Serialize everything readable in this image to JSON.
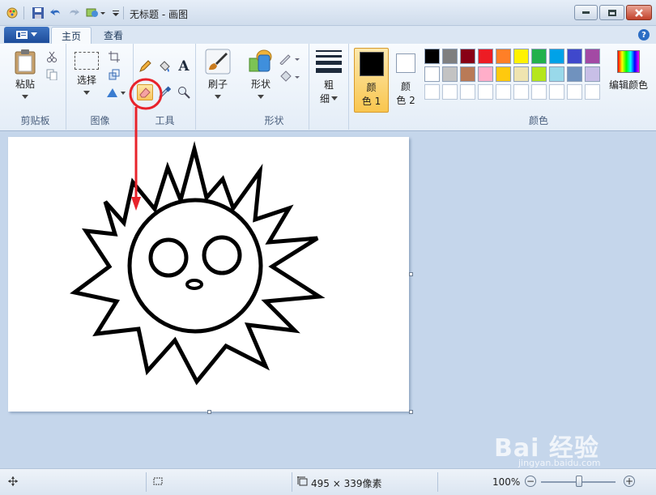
{
  "title_bar": {
    "title": "无标题 - 画图"
  },
  "tabs": {
    "home": "主页",
    "view": "查看"
  },
  "ribbon": {
    "clipboard": {
      "paste": "粘贴",
      "group": "剪贴板"
    },
    "image": {
      "select": "选择",
      "group": "图像"
    },
    "tools": {
      "group": "工具",
      "text_icon": "A"
    },
    "brushes": {
      "label": "刷子"
    },
    "shapes": {
      "label": "形状",
      "group": "形状"
    },
    "size": {
      "line1": "粗",
      "line2": "细"
    },
    "color1": {
      "line1": "颜",
      "line2": "色 1"
    },
    "color2": {
      "line1": "颜",
      "line2": "色 2"
    },
    "colors": {
      "group": "颜色",
      "edit": "编辑颜色"
    }
  },
  "palette_row1": [
    "#000000",
    "#7f7f7f",
    "#880015",
    "#ed1c24",
    "#ff7f27",
    "#fff200",
    "#22b14c",
    "#00a2e8",
    "#3f48cc",
    "#a349a4"
  ],
  "palette_row2": [
    "#ffffff",
    "#c3c3c3",
    "#b97a57",
    "#ffaec9",
    "#ffc90e",
    "#efe4b0",
    "#b5e61d",
    "#99d9ea",
    "#7092be",
    "#c8bfe7"
  ],
  "status": {
    "size": "495 × 339像素",
    "zoom": "100%"
  },
  "watermark": {
    "brand": "Bai 经验",
    "domain": "jingyan.baidu.com"
  }
}
